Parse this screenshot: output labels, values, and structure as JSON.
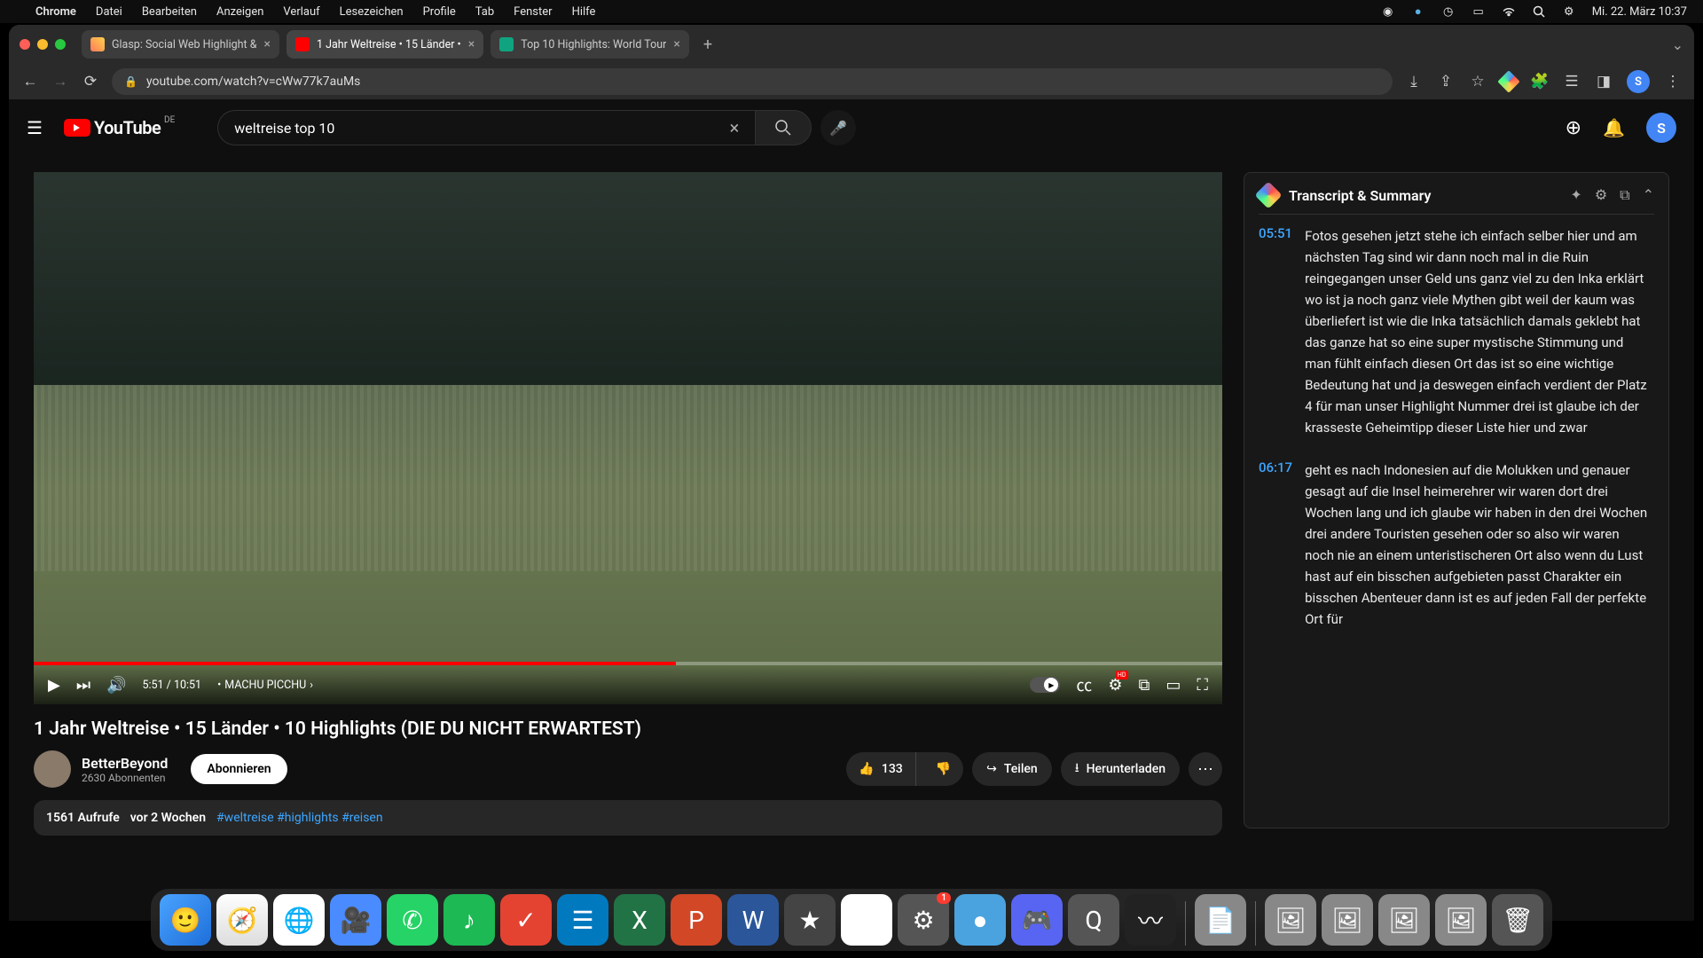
{
  "menubar": {
    "app": "Chrome",
    "items": [
      "Datei",
      "Bearbeiten",
      "Anzeigen",
      "Verlauf",
      "Lesezeichen",
      "Profile",
      "Tab",
      "Fenster",
      "Hilfe"
    ],
    "datetime": "Mi. 22. März  10:37"
  },
  "tabs": [
    {
      "label": "Glasp: Social Web Highlight &",
      "active": false
    },
    {
      "label": "1 Jahr Weltreise • 15 Länder •",
      "active": true
    },
    {
      "label": "Top 10 Highlights: World Tour",
      "active": false
    }
  ],
  "url": "youtube.com/watch?v=cWw77k7auMs",
  "yt": {
    "country": "DE",
    "brand": "YouTube",
    "search_value": "weltreise top 10",
    "avatar": "S"
  },
  "player": {
    "current": "5:51",
    "total": "10:51",
    "chapter": "MACHU PICCHU",
    "hd": "HD"
  },
  "video": {
    "title": "1 Jahr Weltreise • 15 Länder • 10 Highlights (DIE DU NICHT ERWARTEST)",
    "channel": "BetterBeyond",
    "subs": "2630 Abonnenten",
    "subscribe": "Abonnieren",
    "likes": "133",
    "share": "Teilen",
    "download": "Herunterladen",
    "views": "1561 Aufrufe",
    "age": "vor 2 Wochen",
    "tags": "#weltreise #highlights #reisen"
  },
  "sidebar": {
    "title": "Transcript & Summary",
    "entries": [
      {
        "time": "05:51",
        "text": "Fotos gesehen jetzt stehe ich einfach selber  hier und am nächsten Tag sind wir dann noch   mal in die Ruin reingegangen unser Geld  uns ganz viel zu den Inka erklärt wo ist   ja noch ganz viele Mythen gibt weil der kaum  was überliefert ist wie die Inka tatsächlich   damals geklebt hat das ganze hat so eine super  mystische Stimmung und man fühlt einfach diesen Ort das ist so eine wichtige Bedeutung hat und  ja deswegen einfach verdient der Platz 4 für man unser Highlight Nummer drei ist glaube ich der  krasseste Geheimtipp dieser Liste hier und zwar"
      },
      {
        "time": "06:17",
        "text": "geht es nach Indonesien auf die Molukken und  genauer gesagt auf die Insel heimerehrer wir   waren dort drei Wochen lang und ich glaube wir  haben in den drei Wochen drei andere Touristen   gesehen oder so also wir waren noch nie an einem unteristischeren Ort also wenn du Lust hast auf   ein bisschen aufgebieten passt Charakter ein  bisschen Abenteuer dann ist es auf jeden Fall   der perfekte Ort für"
      }
    ]
  },
  "dock_badge": "1"
}
